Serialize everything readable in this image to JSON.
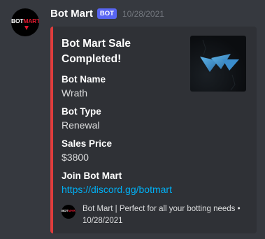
{
  "message": {
    "avatar_logo_text_main": "BOT",
    "avatar_logo_text_accent": "MART",
    "username": "Bot Mart",
    "bot_tag": "BOT",
    "timestamp": "10/28/2021"
  },
  "embed": {
    "accent_color": "#e03c3c",
    "title": "Bot Mart Sale Completed!",
    "thumbnail_icon": "wrath-logo-icon",
    "fields": [
      {
        "name": "Bot Name",
        "value": "Wrath"
      },
      {
        "name": "Bot Type",
        "value": "Renewal"
      },
      {
        "name": "Sales Price",
        "value": "$3800"
      },
      {
        "name": "Join Bot Mart",
        "value": "https://discord.gg/botmart"
      }
    ],
    "footer": {
      "text": "Bot Mart | Perfect for all your botting needs",
      "separator": "•",
      "timestamp": "10/28/2021"
    }
  },
  "colors": {
    "background": "#36393f",
    "embed_background": "#2f3136",
    "bot_tag": "#5865f2",
    "link": "#00aff4"
  }
}
